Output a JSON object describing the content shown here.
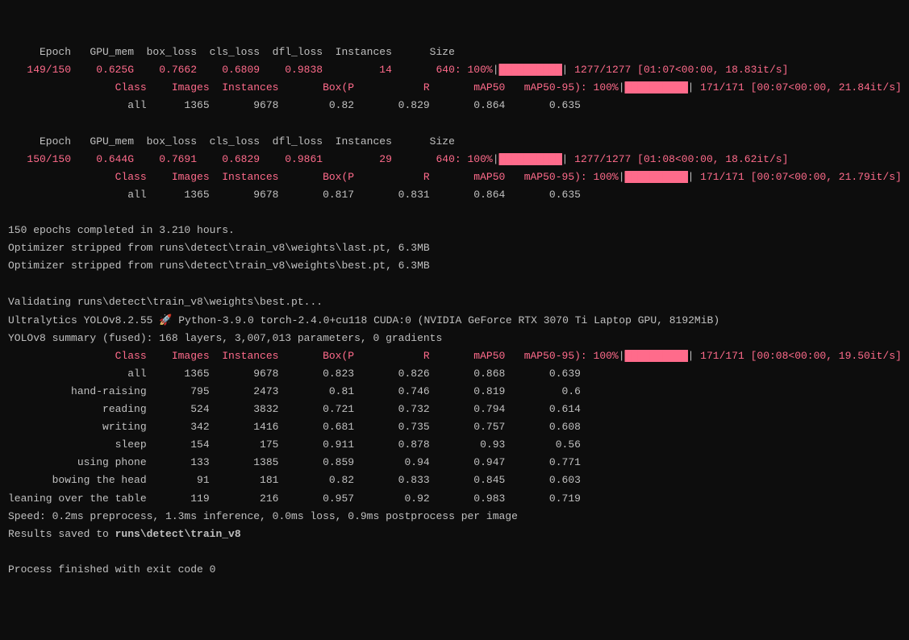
{
  "epoch149": {
    "headers": [
      "Epoch",
      "GPU_mem",
      "box_loss",
      "cls_loss",
      "dfl_loss",
      "Instances",
      "Size"
    ],
    "values": [
      "149/150",
      "0.625G",
      "0.7662",
      "0.6809",
      "0.9838",
      "14",
      "640"
    ],
    "progress": "100%",
    "prog_rest": " 1277/1277 [01:07<00:00, 18.83it/s]",
    "val_headers": [
      "Class",
      "Images",
      "Instances",
      "Box(P",
      "R",
      "mAP50",
      "mAP50-95)"
    ],
    "val_progress": "100%",
    "val_rest": " 171/171 [00:07<00:00, 21.84it/s]",
    "val_row": [
      "all",
      "1365",
      "9678",
      "0.82",
      "0.829",
      "0.864",
      "0.635"
    ]
  },
  "epoch150": {
    "headers": [
      "Epoch",
      "GPU_mem",
      "box_loss",
      "cls_loss",
      "dfl_loss",
      "Instances",
      "Size"
    ],
    "values": [
      "150/150",
      "0.644G",
      "0.7691",
      "0.6829",
      "0.9861",
      "29",
      "640"
    ],
    "progress": "100%",
    "prog_rest": " 1277/1277 [01:08<00:00, 18.62it/s]",
    "val_headers": [
      "Class",
      "Images",
      "Instances",
      "Box(P",
      "R",
      "mAP50",
      "mAP50-95)"
    ],
    "val_progress": "100%",
    "val_rest": " 171/171 [00:07<00:00, 21.79it/s]",
    "val_row": [
      "all",
      "1365",
      "9678",
      "0.817",
      "0.831",
      "0.864",
      "0.635"
    ]
  },
  "completed": "150 epochs completed in 3.210 hours.",
  "opt_last": "Optimizer stripped from runs\\detect\\train_v8\\weights\\last.pt, 6.3MB",
  "opt_best": "Optimizer stripped from runs\\detect\\train_v8\\weights\\best.pt, 6.3MB",
  "validating": "Validating runs\\detect\\train_v8\\weights\\best.pt...",
  "ultralytics": "Ultralytics YOLOv8.2.55 ",
  "rocket": "🚀",
  "ultra_rest": " Python-3.9.0 torch-2.4.0+cu118 CUDA:0 (NVIDIA GeForce RTX 3070 Ti Laptop GPU, 8192MiB)",
  "summary": "YOLOv8 summary (fused): 168 layers, 3,007,013 parameters, 0 gradients",
  "final_headers": [
    "Class",
    "Images",
    "Instances",
    "Box(P",
    "R",
    "mAP50",
    "mAP50-95)"
  ],
  "final_progress": "100%",
  "final_rest": " 171/171 [00:08<00:00, 19.50it/s]",
  "final_rows": [
    [
      "all",
      "1365",
      "9678",
      "0.823",
      "0.826",
      "0.868",
      "0.639"
    ],
    [
      "hand-raising",
      "795",
      "2473",
      "0.81",
      "0.746",
      "0.819",
      "0.6"
    ],
    [
      "reading",
      "524",
      "3832",
      "0.721",
      "0.732",
      "0.794",
      "0.614"
    ],
    [
      "writing",
      "342",
      "1416",
      "0.681",
      "0.735",
      "0.757",
      "0.608"
    ],
    [
      "sleep",
      "154",
      "175",
      "0.911",
      "0.878",
      "0.93",
      "0.56"
    ],
    [
      "using phone",
      "133",
      "1385",
      "0.859",
      "0.94",
      "0.947",
      "0.771"
    ],
    [
      "bowing the head",
      "91",
      "181",
      "0.82",
      "0.833",
      "0.845",
      "0.603"
    ],
    [
      "leaning over the table",
      "119",
      "216",
      "0.957",
      "0.92",
      "0.983",
      "0.719"
    ]
  ],
  "speed": "Speed: 0.2ms preprocess, 1.3ms inference, 0.0ms loss, 0.9ms postprocess per image",
  "results_saved": "Results saved to ",
  "results_path": "runs\\detect\\train_v8",
  "process_finished": "Process finished with exit code 0",
  "bar_fill": "██████████"
}
